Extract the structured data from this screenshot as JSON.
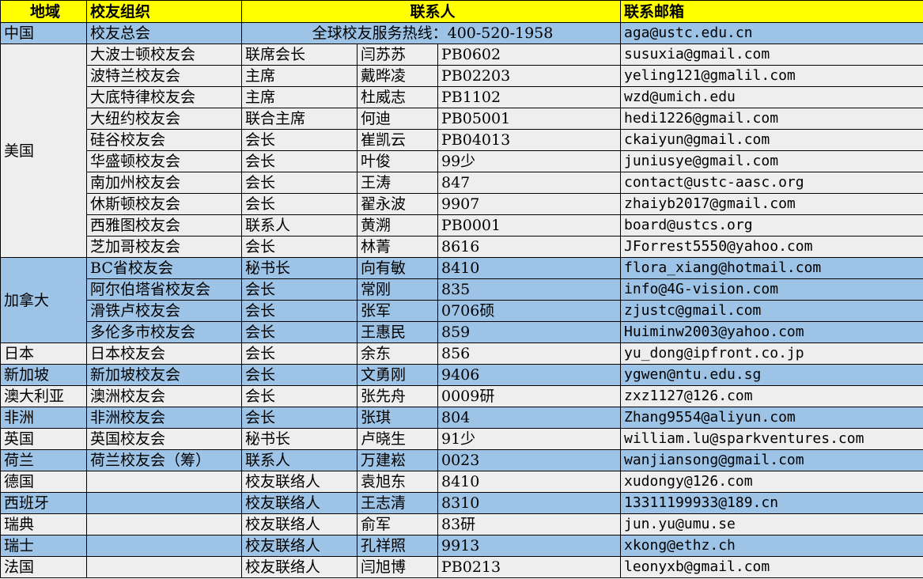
{
  "headers": {
    "region": "地域",
    "org": "校友组织",
    "contact": "联系人",
    "email": "联系邮箱"
  },
  "china": {
    "region": "中国",
    "org": "校友总会",
    "hotline": "全球校友服务热线：400-520-1958",
    "email": "aga@ustc.edu.cn"
  },
  "usa": {
    "region": "美国",
    "rows": [
      {
        "org": "大波士顿校友会",
        "title": "联席会长",
        "name": "闫苏苏",
        "class": "PB0602",
        "email": "susuxia@gmail.com"
      },
      {
        "org": "波特兰校友会",
        "title": "主席",
        "name": "戴晔凌",
        "class": "PB02203",
        "email": "yeling121@gmalil.com"
      },
      {
        "org": "大底特律校友会",
        "title": "主席",
        "name": "杜威志",
        "class": "PB1102",
        "email": "wzd@umich.edu"
      },
      {
        "org": "大纽约校友会",
        "title": "联合主席",
        "name": "何迪",
        "class": "PB05001",
        "email": "hedi1226@gmail.com"
      },
      {
        "org": "硅谷校友会",
        "title": "会长",
        "name": "崔凯云",
        "class": "PB04013",
        "email": "ckaiyun@gmail.com"
      },
      {
        "org": "华盛顿校友会",
        "title": "会长",
        "name": "叶俊",
        "class": "99少",
        "email": "juniusye@gmail.com"
      },
      {
        "org": "南加州校友会",
        "title": "会长",
        "name": "王涛",
        "class": "847",
        "email": "contact@ustc-aasc.org"
      },
      {
        "org": "休斯顿校友会",
        "title": "会长",
        "name": "翟永波",
        "class": "9907",
        "email": "zhaiyb2017@gmail.com"
      },
      {
        "org": "西雅图校友会",
        "title": "联系人",
        "name": "黄溯",
        "class": "PB0001",
        "email": "board@ustcs.org"
      },
      {
        "org": "芝加哥校友会",
        "title": "会长",
        "name": "林菁",
        "class": "8616",
        "email": "JForrest5550@yahoo.com"
      }
    ]
  },
  "canada": {
    "region": "加拿大",
    "rows": [
      {
        "org": "BC省校友会",
        "title": "秘书长",
        "name": "向有敏",
        "class": "8410",
        "email": "flora_xiang@hotmail.com"
      },
      {
        "org": "阿尔伯塔省校友会",
        "title": "会长",
        "name": "常刚",
        "class": "835",
        "email": "info@4G-vision.com"
      },
      {
        "org": "滑铁卢校友会",
        "title": "会长",
        "name": "张军",
        "class": "0706硕",
        "email": "zjustc@gmail.com"
      },
      {
        "org": "多伦多市校友会",
        "title": "会长",
        "name": "王惠民",
        "class": "859",
        "email": "Huiminw2003@yahoo.com"
      }
    ]
  },
  "others": [
    {
      "region": "日本",
      "org": "日本校友会",
      "title": "会长",
      "name": "余东",
      "class": "856",
      "email": "yu_dong@ipfront.co.jp"
    },
    {
      "region": "新加坡",
      "org": "新加坡校友会",
      "title": "会长",
      "name": "文勇刚",
      "class": "9406",
      "email": "ygwen@ntu.edu.sg"
    },
    {
      "region": "澳大利亚",
      "org": "澳洲校友会",
      "title": "会长",
      "name": "张先舟",
      "class": "0009研",
      "email": "zxz1127@126.com"
    },
    {
      "region": "非洲",
      "org": "非洲校友会",
      "title": "会长",
      "name": "张琪",
      "class": "804",
      "email": "Zhang9554@aliyun.com"
    },
    {
      "region": "英国",
      "org": "英国校友会",
      "title": "秘书长",
      "name": "卢晓生",
      "class": "91少",
      "email": "william.lu@sparkventures.com"
    },
    {
      "region": "荷兰",
      "org": "荷兰校友会（筹）",
      "title": "联系人",
      "name": "万建崧",
      "class": "0023",
      "email": "wanjiansong@gmail.com"
    },
    {
      "region": "德国",
      "org": "",
      "title": "校友联络人",
      "name": "袁旭东",
      "class": "8410",
      "email": "xudongy@126.com"
    },
    {
      "region": "西班牙",
      "org": "",
      "title": "校友联络人",
      "name": "王志清",
      "class": "8310",
      "email": "13311199933@189.cn"
    },
    {
      "region": "瑞典",
      "org": "",
      "title": "校友联络人",
      "name": "俞军",
      "class": "83研",
      "email": "jun.yu@umu.se"
    },
    {
      "region": "瑞士",
      "org": "",
      "title": "校友联络人",
      "name": "孔祥照",
      "class": "9913",
      "email": "xkong@ethz.ch"
    },
    {
      "region": "法国",
      "org": "",
      "title": "校友联络人",
      "name": "闫旭博",
      "class": "PB0213",
      "email": "leonyxb@gmail.com"
    }
  ],
  "colors": {
    "header": "#ffff00",
    "blue_row": "#9dc3e6",
    "gray_row": "#eeeeee",
    "border": "#000000"
  }
}
